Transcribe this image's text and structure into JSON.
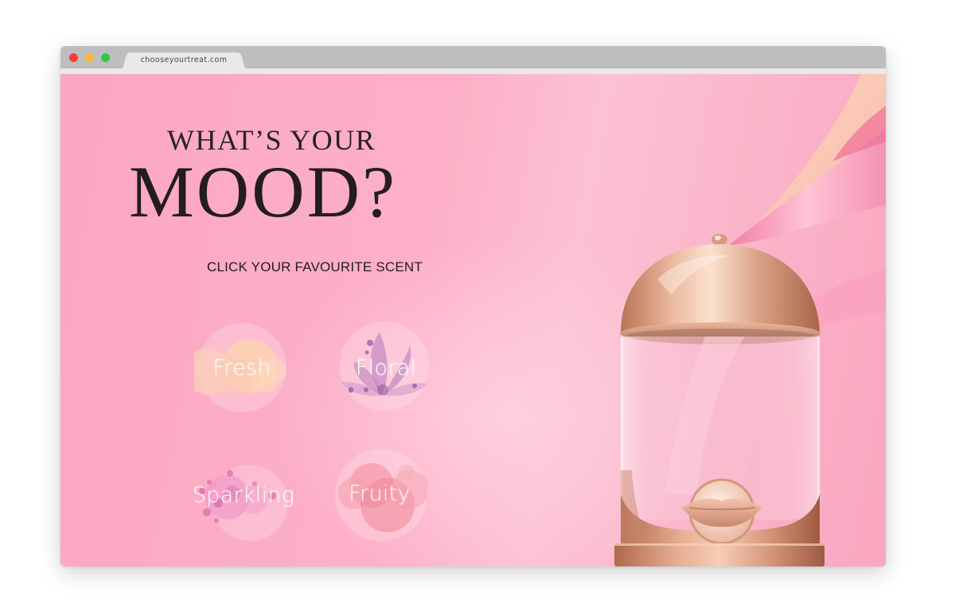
{
  "browser": {
    "url": "chooseyourtreat.com",
    "window_controls": [
      "close",
      "minimize",
      "maximize"
    ]
  },
  "hero": {
    "title_line1": "WHAT’S YOUR",
    "title_line2": "MOOD?",
    "subtitle": "CLICK YOUR FAVOURITE SCENT"
  },
  "scents": [
    {
      "label": "Fresh"
    },
    {
      "label": "Floral"
    },
    {
      "label": "Sparkling"
    },
    {
      "label": "Fruity"
    }
  ],
  "colors": {
    "background": "#fba6c2",
    "rose_gold": "#d99a7f",
    "heading": "#241c1f"
  },
  "icons": [
    "ribbon-decoration",
    "dispenser-jar",
    "lip-sample"
  ]
}
